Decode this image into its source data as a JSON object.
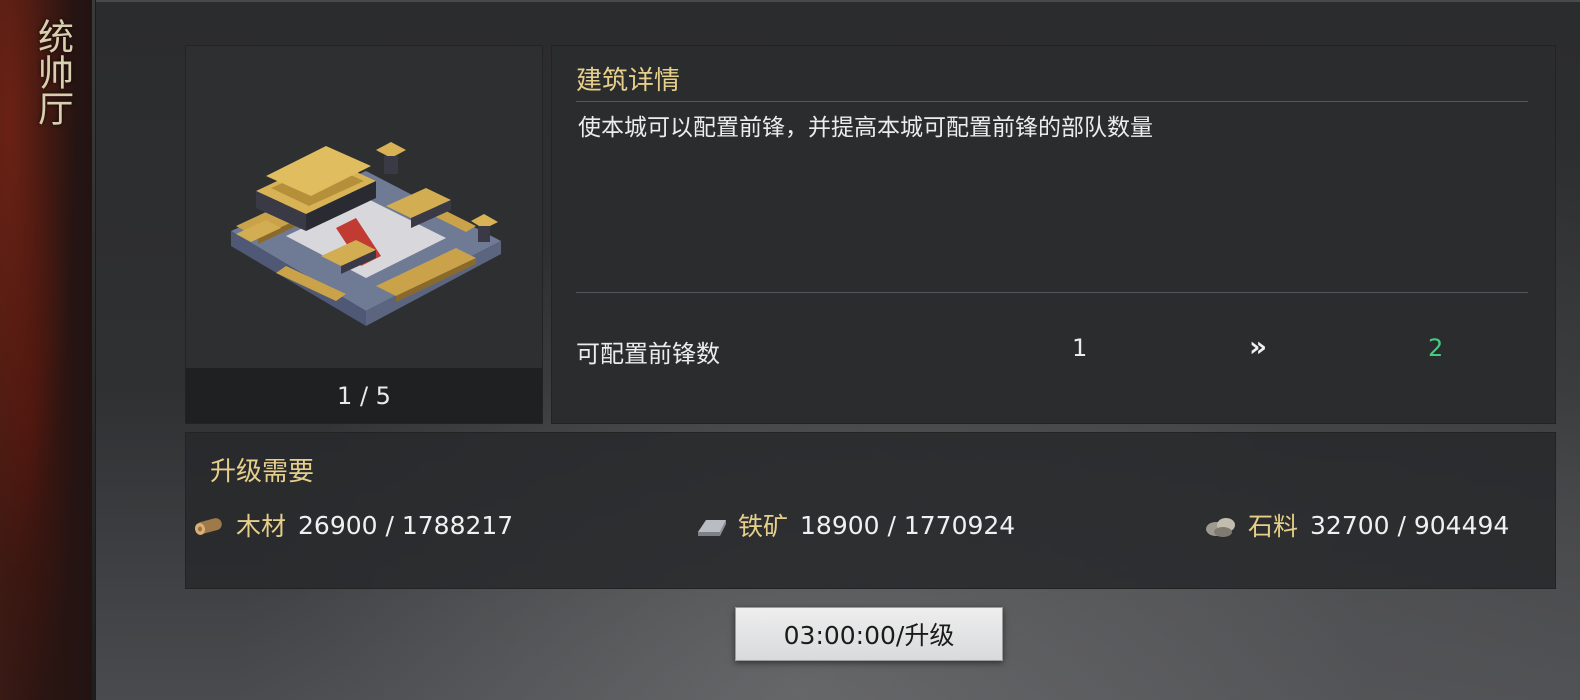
{
  "sidebar": {
    "title": "统帅厅"
  },
  "building": {
    "pager": "1 / 5"
  },
  "detail": {
    "title": "建筑详情",
    "description": "使本城可以配置前锋，并提高本城可配置前锋的部队数量",
    "stat": {
      "label": "可配置前锋数",
      "current": "1",
      "arrow": "»",
      "next": "2"
    }
  },
  "requirements": {
    "title": "升级需要",
    "resources": [
      {
        "icon": "wood-log-icon",
        "name": "木材",
        "value": "26900 / 1788217"
      },
      {
        "icon": "iron-ingot-icon",
        "name": "铁矿",
        "value": "18900 / 1770924"
      },
      {
        "icon": "stone-icon",
        "name": "石料",
        "value": "32700 / 904494"
      }
    ]
  },
  "upgrade_button": {
    "label": "03:00:00/升级"
  },
  "colors": {
    "gold_text": "#e6cf8b",
    "next_value": "#3fcf7e",
    "panel_bg": "#2b2c2e"
  }
}
